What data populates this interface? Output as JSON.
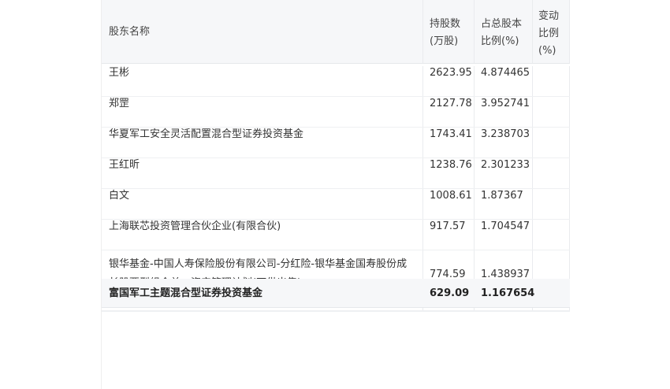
{
  "table": {
    "headers": {
      "name": "股东名称",
      "holding": "持股数(万股)",
      "percent": "占总股本比例(%)",
      "change": "变动比例(%)"
    },
    "rows": [
      {
        "name": "王彬",
        "holding": "2623.95",
        "percent": "4.874465",
        "change": ""
      },
      {
        "name": "郑罡",
        "holding": "2127.78",
        "percent": "3.952741",
        "change": ""
      },
      {
        "name": "华夏军工安全灵活配置混合型证券投资基金",
        "holding": "1743.41",
        "percent": "3.238703",
        "change": ""
      },
      {
        "name": "王红昕",
        "holding": "1238.76",
        "percent": "2.301233",
        "change": ""
      },
      {
        "name": "白文",
        "holding": "1008.61",
        "percent": "1.87367",
        "change": ""
      },
      {
        "name": "上海联芯投资管理合伙企业(有限合伙)",
        "holding": "917.57",
        "percent": "1.704547",
        "change": ""
      },
      {
        "name": "银华基金-中国人寿保险股份有限公司-分红险-银华基金国寿股份成长股票型组合单一资产管理计划(可供出售)",
        "holding": "774.59",
        "percent": "1.438937",
        "change": ""
      }
    ],
    "overlap_row": {
      "name": "富国军工主题混合型证券投资基金",
      "holding": "629.09",
      "percent": "1.167654"
    }
  }
}
